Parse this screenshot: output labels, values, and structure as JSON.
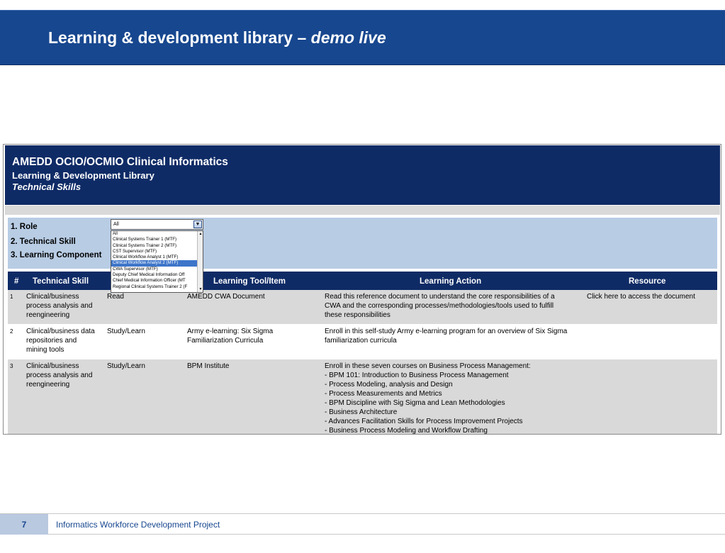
{
  "slide": {
    "title_main": "Learning & development library – ",
    "title_italic": "demo live",
    "page_number": "7",
    "footer_text": "Informatics Workforce Development Project"
  },
  "banner": {
    "line1": "AMEDD OCIO/OCMIO Clinical Informatics",
    "line2": "Learning & Development Library",
    "line3": "Technical Skills"
  },
  "filters": {
    "role_label": "1. Role",
    "skill_label": "2. Technical Skill",
    "component_label": "3. Learning Component",
    "role_value": "All",
    "role_options": [
      "All",
      "Clinical Systems Trainer 1 (MTF)",
      "Clinical Systems Trainer 2 (MTF)",
      "CST Supervisor (MTF)",
      "Clinical Workflow Analyst 1 (MTF)",
      "Clinical Workflow Analyst 2 (MTF)",
      "CWA Supervisor (MTF)",
      "Deputy Chief Medical Information Off",
      "Chief Medical Information Officer (MT",
      "Regional Clinical Systems Trainer 2 (F"
    ],
    "selected_index": 5
  },
  "table": {
    "headers": [
      "#",
      "Technical Skill",
      "Learning Tool/Item",
      "Learning Action",
      "Resource"
    ],
    "rows": [
      {
        "num": "1",
        "skill": [
          "Clinical/business",
          "process analysis and",
          "reengineering"
        ],
        "type": "Read",
        "tool": [
          "AMEDD CWA Document"
        ],
        "action": [
          "Read this reference document to understand the core responsibilities of a",
          "CWA and the corresponding processes/methodologies/tools used to fulfill",
          "these responsibilities"
        ],
        "resource": "Click here to access the document"
      },
      {
        "num": "2",
        "skill": [
          "Clinical/business data",
          "repositories and",
          "mining tools"
        ],
        "type": "Study/Learn",
        "tool": [
          "Army e-learning: Six Sigma",
          "Familiarization Curricula"
        ],
        "action": [
          "Enroll in this self-study Army e-learning program for an overview of Six Sigma",
          "familiarization curricula"
        ],
        "resource": ""
      },
      {
        "num": "3",
        "skill": [
          "Clinical/business",
          "process analysis and",
          "reengineering"
        ],
        "type": "Study/Learn",
        "tool": [
          "BPM Institute"
        ],
        "action": [
          "Enroll in these  seven courses on Business Process Management:",
          "- BPM 101:  Introduction to Business Process Management",
          "- Process Modeling, analysis and Design",
          "- Process Measurements and Metrics",
          "- BPM Discipline with Sig Sigma and Lean Methodologies",
          "- Business Architecture",
          "- Advances Facilitation Skills for Process Improvement Projects",
          "- Business Process Modeling and Workflow Drafting"
        ],
        "resource": ""
      }
    ]
  }
}
